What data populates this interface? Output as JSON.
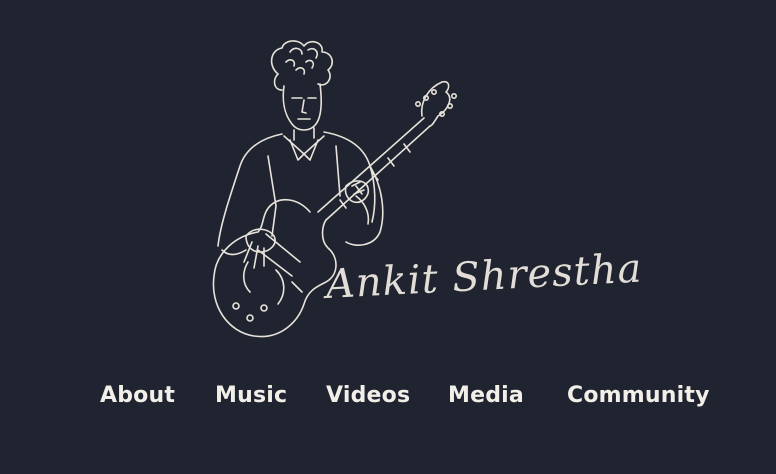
{
  "logo": {
    "signature": "Ankit Shrestha",
    "illustration": "line-drawing-guitarist-icon"
  },
  "nav": {
    "items": [
      {
        "label": "About"
      },
      {
        "label": "Music"
      },
      {
        "label": "Videos"
      },
      {
        "label": "Media"
      },
      {
        "label": "Community"
      }
    ]
  },
  "colors": {
    "background": "#1f2430",
    "line": "#e8e3da",
    "text": "#f2efe9"
  }
}
